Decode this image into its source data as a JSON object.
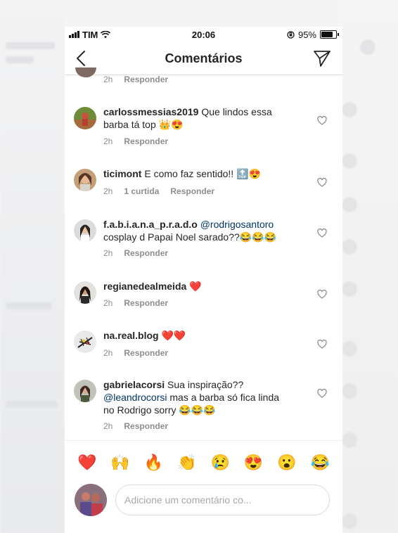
{
  "status_bar": {
    "carrier": "TIM",
    "time": "20:06",
    "battery": "95%"
  },
  "nav": {
    "title": "Comentários",
    "back_icon": "chevron-left-icon",
    "send_icon": "paper-plane-icon"
  },
  "partial_row": {
    "time": "2h",
    "reply": "Responder"
  },
  "comments": [
    {
      "username": "carlossmessias2019",
      "text": "Que lindos essa barba tá top 👑😍",
      "time": "2h",
      "likes": "",
      "reply": "Responder"
    },
    {
      "username": "ticimont",
      "text": "E como  faz sentido!! 🔝😍",
      "time": "2h",
      "likes": "1 curtida",
      "reply": "Responder"
    },
    {
      "username": "f.a.b.i.a.n.a_p.r.a.d.o",
      "mention": "@rodrigosantoro",
      "text": "cosplay d Papai Noel sarado??😂😂😂",
      "time": "2h",
      "likes": "",
      "reply": "Responder"
    },
    {
      "username": "regianedealmeida",
      "text": "❤️",
      "time": "2h",
      "likes": "",
      "reply": "Responder"
    },
    {
      "username": "na.real.blog",
      "text": "❤️❤️",
      "time": "2h",
      "likes": "",
      "reply": "Responder"
    },
    {
      "username": "gabrielacorsi",
      "text_before": "Sua inspiração??",
      "mention": "@leandrocorsi",
      "text": " mas a barba só fica linda no Rodrigo sorry 😂😂😂",
      "time": "2h",
      "likes": "",
      "reply": "Responder"
    }
  ],
  "emoji_bar": [
    "❤️",
    "🙌",
    "🔥",
    "👏",
    "😢",
    "😍",
    "😮",
    "😂"
  ],
  "composer": {
    "placeholder": "Adicione um comentário co..."
  },
  "colors": {
    "link": "#003569",
    "muted": "#8e8e8e",
    "text": "#262626",
    "border": "#dbdbdb"
  }
}
